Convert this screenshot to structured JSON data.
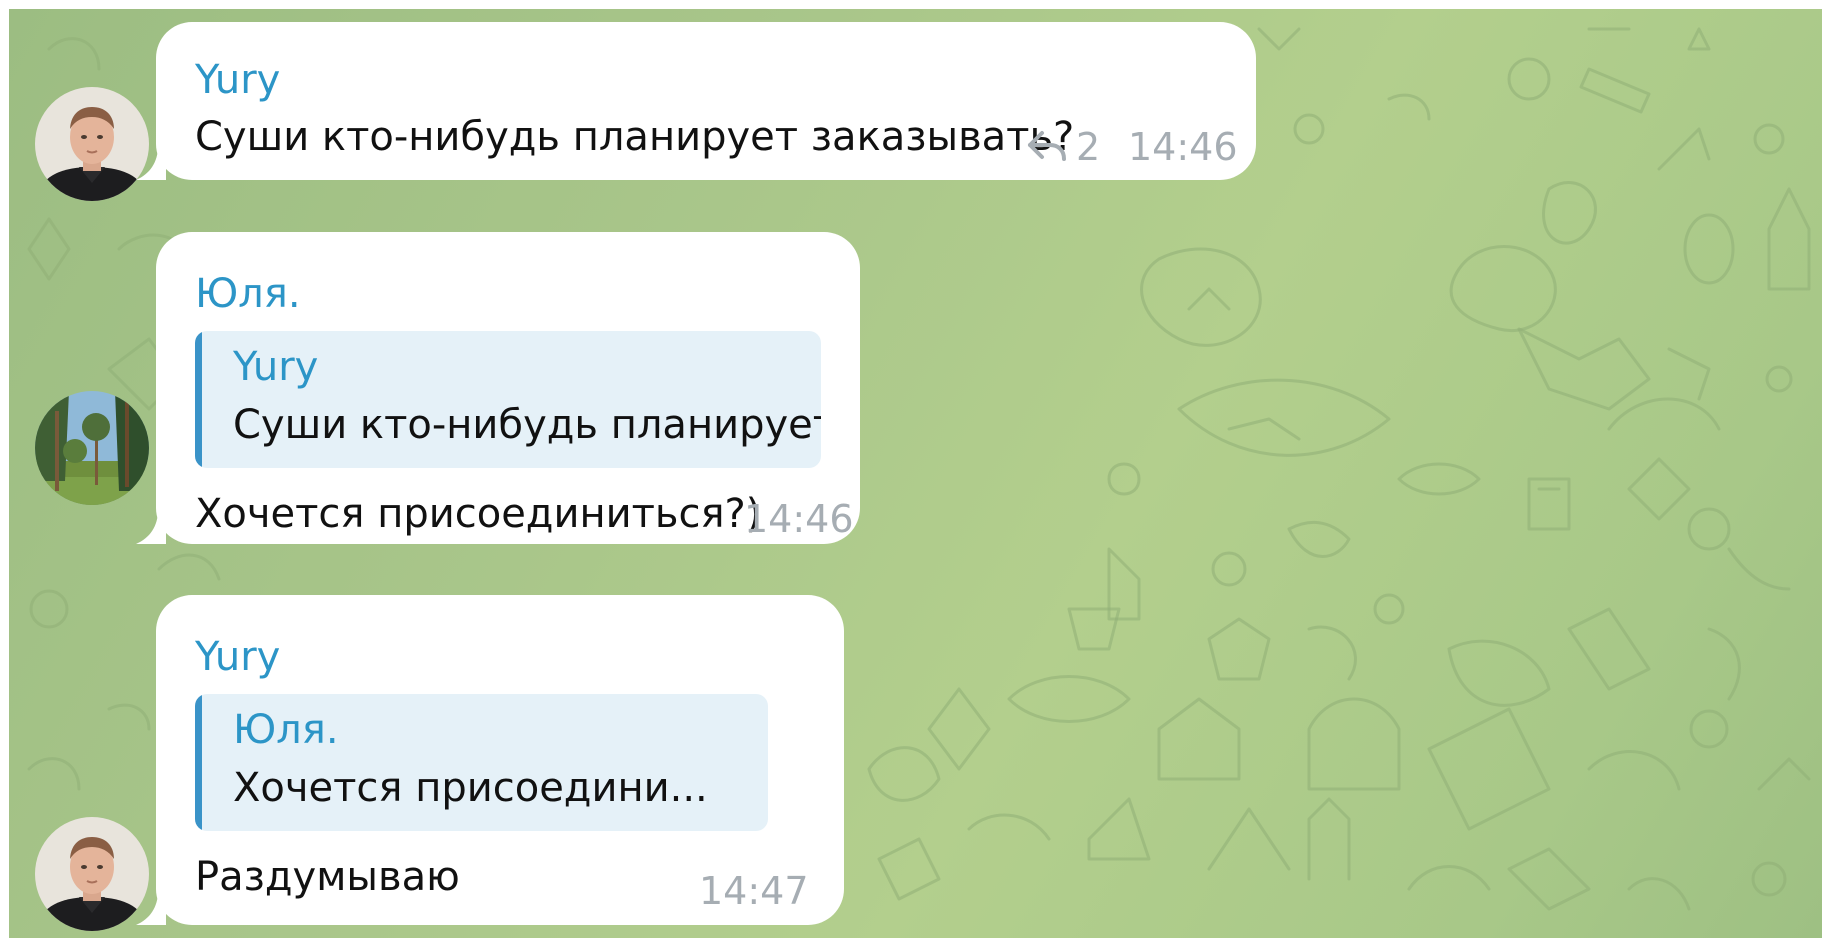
{
  "theme": {
    "sender_color": "#2c95c7",
    "quote_bar_color": "#3a93c8",
    "quote_bg_color": "#e5f1f8",
    "time_color": "#a6adb3",
    "wallpaper_color": "#a9c68a"
  },
  "messages": [
    {
      "sender": "Yury",
      "avatar": "user-photo-yury",
      "text": "Суши кто-нибудь планирует заказывать?",
      "time": "14:46",
      "replies_icon": "reply-arrow-icon",
      "replies_count": "2"
    },
    {
      "sender": "Юля.",
      "avatar": "user-photo-forest",
      "quote": {
        "sender": "Yury",
        "text": "Суши кто-нибудь планирует ..."
      },
      "text": "Хочется присоединиться?)",
      "time": "14:46"
    },
    {
      "sender": "Yury",
      "avatar": "user-photo-yury",
      "quote": {
        "sender": "Юля.",
        "text": "Хочется присоедини..."
      },
      "text": "Раздумываю",
      "time": "14:47"
    }
  ]
}
